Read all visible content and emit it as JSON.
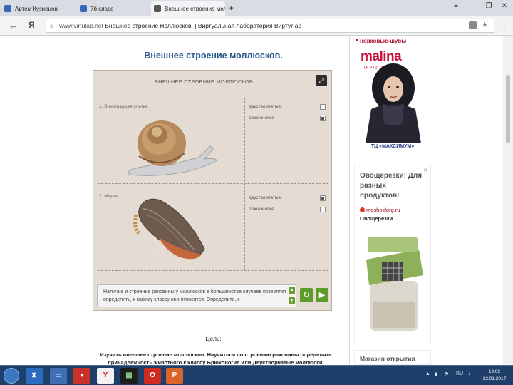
{
  "browser": {
    "tabs": [
      {
        "label": "Артем Кузнецов",
        "active": false,
        "favicon_color": "#3a66b8"
      },
      {
        "label": "7б класс",
        "active": false,
        "favicon_color": "#3a66b8"
      },
      {
        "label": "Внешнее строение молл",
        "active": true,
        "favicon_color": "#555555",
        "close": "✕"
      }
    ],
    "new_tab": "+",
    "window_controls": {
      "menu": "≡",
      "minimize": "–",
      "restore": "❐",
      "close": "✕"
    },
    "nav": {
      "back": "←",
      "yandex": "Я"
    },
    "url_host": "www.virtulab.net",
    "url_title": "Внешнее строение моллюсков. | Виртуальная лаборатория ВиртуЛаб",
    "url_actions": {
      "bookmark": "★",
      "menu": "⋮"
    }
  },
  "page": {
    "title": "Внешнее строение моллюсков.",
    "lab": {
      "title": "ВНЕШНЕЕ СТРОЕНИЕ МОЛЛЮСКОВ",
      "rows": [
        {
          "label": "1.  Виноградная улитка",
          "options": [
            {
              "text": "двустворчатые",
              "checked": false
            },
            {
              "text": "брюхоногие",
              "checked": true
            }
          ]
        },
        {
          "label": "2.  Мидия",
          "options": [
            {
              "text": "двустворчатые",
              "checked": true
            },
            {
              "text": "брюхоногие",
              "checked": false
            }
          ]
        }
      ],
      "info": "Наличие и строение раковины у моллюсков в большинстве случаев позволяет определить, к какому классу они относятся. Определите, к",
      "scroll_up": "▲",
      "scroll_down": "▼",
      "reset_icon": "↻",
      "next_icon": "▶"
    },
    "goal_heading": "Цель:",
    "goal_text": "Изучить внешнее строение моллюсков. Научиться по строению раковины определять принадлежность животного к классу Брюхоногие или Двустворчатые моллюски. Научиться"
  },
  "ads": {
    "ad1": {
      "top_text": "норковые-шубы",
      "brand": "malina",
      "brand_sub": "центр меха",
      "footer": "ТЦ «МАКСИМУМ»"
    },
    "ad2": {
      "headline": "Овощерезки! Для разных продуктов!",
      "link": "moshozlorg.ru",
      "name": "Овощерезки",
      "close": "✕"
    },
    "ad3": {
      "headline": "Магазин открытия"
    }
  },
  "taskbar": {
    "clock_time": "19:02",
    "clock_date": "22.01.2017",
    "lang": "RU"
  },
  "colors": {
    "title_blue": "#2b5b8c",
    "brand_red": "#c8103b",
    "lab_bg": "#e4dbd3",
    "green_btn": "#5d9b2a"
  }
}
